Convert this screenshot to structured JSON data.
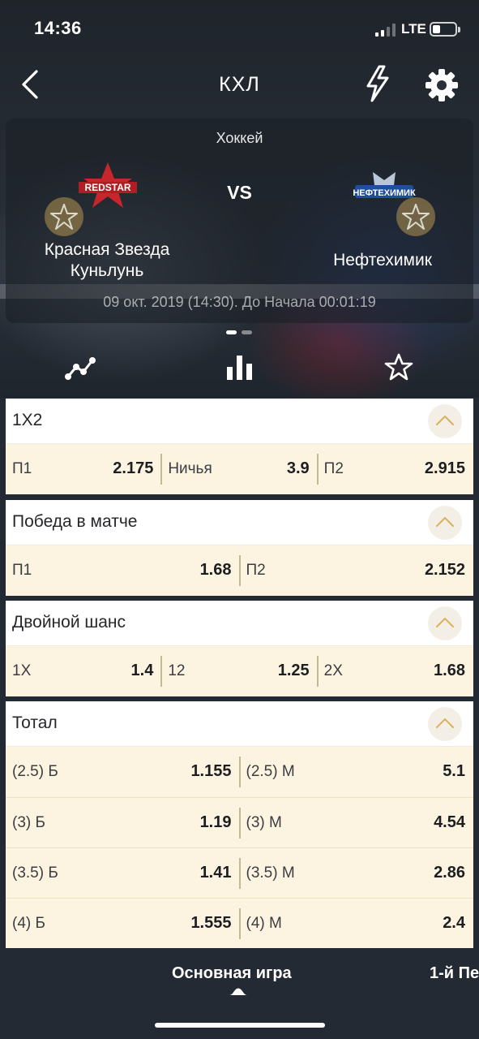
{
  "status_bar": {
    "time": "14:36",
    "network": "LTE",
    "battery_level": 0.35
  },
  "nav": {
    "title": "КХЛ"
  },
  "match": {
    "sport": "Хоккей",
    "vs_label": "VS",
    "home_team": {
      "name_line1": "Красная Звезда",
      "name_line2": "Куньлунь",
      "logo_text": "REDSTAR"
    },
    "away_team": {
      "name_line1": "Нефтехимик",
      "logo_text": "НЕФТЕХИМИК"
    },
    "start_info": "09 окт. 2019 (14:30). До Начала   00:01:19"
  },
  "pager": {
    "count": 2,
    "active": 0
  },
  "markets": [
    {
      "title": "1X2",
      "rows": [
        [
          {
            "label": "П1",
            "value": "2.175"
          },
          {
            "label": "Ничья",
            "value": "3.9"
          },
          {
            "label": "П2",
            "value": "2.915"
          }
        ]
      ]
    },
    {
      "title": "Победа в матче",
      "rows": [
        [
          {
            "label": "П1",
            "value": "1.68"
          },
          {
            "label": "П2",
            "value": "2.152"
          }
        ]
      ]
    },
    {
      "title": "Двойной шанс",
      "rows": [
        [
          {
            "label": "1X",
            "value": "1.4"
          },
          {
            "label": "12",
            "value": "1.25"
          },
          {
            "label": "2X",
            "value": "1.68"
          }
        ]
      ]
    },
    {
      "title": "Тотал",
      "rows": [
        [
          {
            "label": "(2.5) Б",
            "value": "1.155"
          },
          {
            "label": "(2.5) М",
            "value": "5.1"
          }
        ],
        [
          {
            "label": "(3) Б",
            "value": "1.19"
          },
          {
            "label": "(3) М",
            "value": "4.54"
          }
        ],
        [
          {
            "label": "(3.5) Б",
            "value": "1.41"
          },
          {
            "label": "(3.5) М",
            "value": "2.86"
          }
        ],
        [
          {
            "label": "(4) Б",
            "value": "1.555"
          },
          {
            "label": "(4) М",
            "value": "2.4"
          }
        ]
      ]
    }
  ],
  "bottom_tabs": {
    "main": "Основная игра",
    "next": "1-й Пе"
  },
  "colors": {
    "accent": "#d9b25a",
    "odds_bg": "#fcf4e1",
    "dark_bg": "#232a33"
  }
}
